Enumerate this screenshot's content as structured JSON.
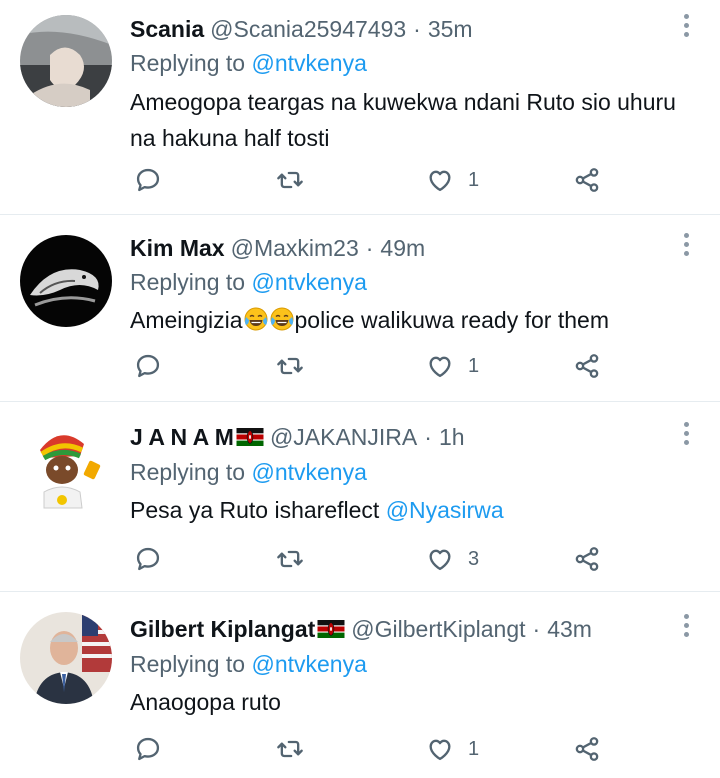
{
  "tweets": [
    {
      "display_name": "Scania",
      "handle": "@Scania25947493",
      "separator": "·",
      "time": "35m",
      "replying_prefix": "Replying to",
      "replying_to": "@ntvkenya",
      "text": "Ameogopa teargas na kuwekwa ndani Ruto sio uhuru na hakuna half tosti",
      "likes": "1"
    },
    {
      "display_name": "Kim Max",
      "handle": "@Maxkim23",
      "separator": "·",
      "time": "49m",
      "replying_prefix": "Replying to",
      "replying_to": "@ntvkenya",
      "text_before": "Ameingizia",
      "emoji": "😂😂",
      "text_after": "police walikuwa ready for them",
      "likes": "1"
    },
    {
      "display_name": "J A N A M",
      "handle": "@JAKANJIRA",
      "separator": "·",
      "time": "1h",
      "replying_prefix": "Replying to",
      "replying_to": "@ntvkenya",
      "text": "Pesa ya Ruto ishareflect ",
      "text_mention": "@Nyasirwa",
      "likes": "3"
    },
    {
      "display_name": "Gilbert Kiplangat",
      "handle": "@GilbertKiplangt",
      "separator": "·",
      "time": "43m",
      "replying_prefix": "Replying to",
      "replying_to": "@ntvkenya",
      "text": "Anaogopa ruto",
      "likes": "1"
    }
  ],
  "colors": {
    "link": "#1d9bf0",
    "secondary_text": "#536471",
    "primary_text": "#0f1419",
    "divider": "#e6ecf0"
  },
  "icons": [
    "reply-icon",
    "retweet-icon",
    "like-icon",
    "share-icon",
    "more-icon",
    "kenya-flag-icon",
    "tears-of-joy-emoji"
  ]
}
